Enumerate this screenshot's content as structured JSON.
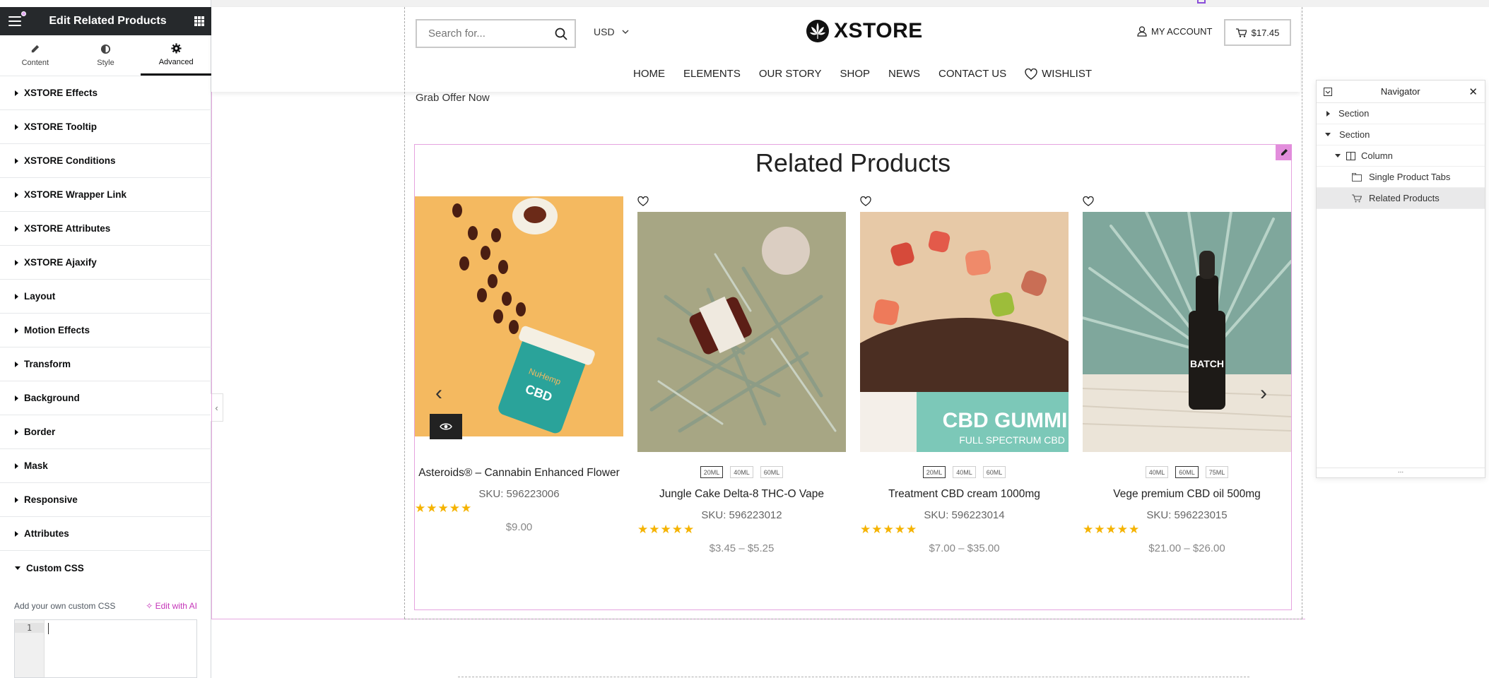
{
  "panel": {
    "title": "Edit Related Products",
    "tabs": [
      {
        "label": "Content",
        "icon": "pencil-icon"
      },
      {
        "label": "Style",
        "icon": "half-circle-icon"
      },
      {
        "label": "Advanced",
        "icon": "gear-icon",
        "active": true
      }
    ],
    "sections": [
      "XSTORE Effects",
      "XSTORE Tooltip",
      "XSTORE Conditions",
      "XSTORE Wrapper Link",
      "XSTORE Attributes",
      "XSTORE Ajaxify",
      "Layout",
      "Motion Effects",
      "Transform",
      "Background",
      "Border",
      "Mask",
      "Responsive",
      "Attributes",
      "Custom CSS"
    ],
    "custom_css_label": "Add your own custom CSS",
    "edit_ai_label": "Edit with AI",
    "line_number": "1"
  },
  "header": {
    "search_placeholder": "Search for...",
    "currency": "USD",
    "logo": "XSTORE",
    "account": "MY ACCOUNT",
    "cart_total": "$17.45",
    "nav": [
      "HOME",
      "ELEMENTS",
      "OUR STORY",
      "SHOP",
      "NEWS",
      "CONTACT US"
    ],
    "wishlist": "WISHLIST"
  },
  "grab_offer": "Grab Offer Now",
  "related": {
    "title": "Related Products",
    "products": [
      {
        "name": "Asteroids® – Cannabin Enhanced Flower",
        "sku": "SKU: 596223006",
        "price": "$9.00",
        "stars": "★★★★★",
        "swatches": []
      },
      {
        "name": "Jungle Cake Delta-8 THC-O Vape",
        "sku": "SKU: 596223012",
        "price": "$3.45 – $5.25",
        "stars": "★★★★★",
        "swatches": [
          "20ML",
          "40ML",
          "60ML"
        ],
        "selected": 0
      },
      {
        "name": "Treatment CBD cream 1000mg",
        "sku": "SKU: 596223014",
        "price": "$7.00 – $35.00",
        "stars": "★★★★★",
        "swatches": [
          "20ML",
          "40ML",
          "60ML"
        ],
        "selected": 0
      },
      {
        "name": "Vege premium CBD oil 500mg",
        "sku": "SKU: 596223015",
        "price": "$21.00 – $26.00",
        "stars": "★★★★★",
        "swatches": [
          "40ML",
          "60ML",
          "75ML"
        ],
        "selected": 1
      }
    ]
  },
  "navigator": {
    "title": "Navigator",
    "items": [
      {
        "label": "Section",
        "level": 0,
        "state": "collapsed"
      },
      {
        "label": "Section",
        "level": 0,
        "state": "expanded"
      },
      {
        "label": "Column",
        "level": 1,
        "state": "expanded"
      },
      {
        "label": "Single Product Tabs",
        "level": 2,
        "state": "leaf"
      },
      {
        "label": "Related Products",
        "level": 2,
        "state": "leaf",
        "selected": true
      }
    ],
    "footer": "..."
  },
  "colors": {
    "panel_header_bg": "#26292c",
    "editor_pink": "#e28ddc",
    "star": "#f5b301",
    "ai_link": "#c535b9"
  }
}
